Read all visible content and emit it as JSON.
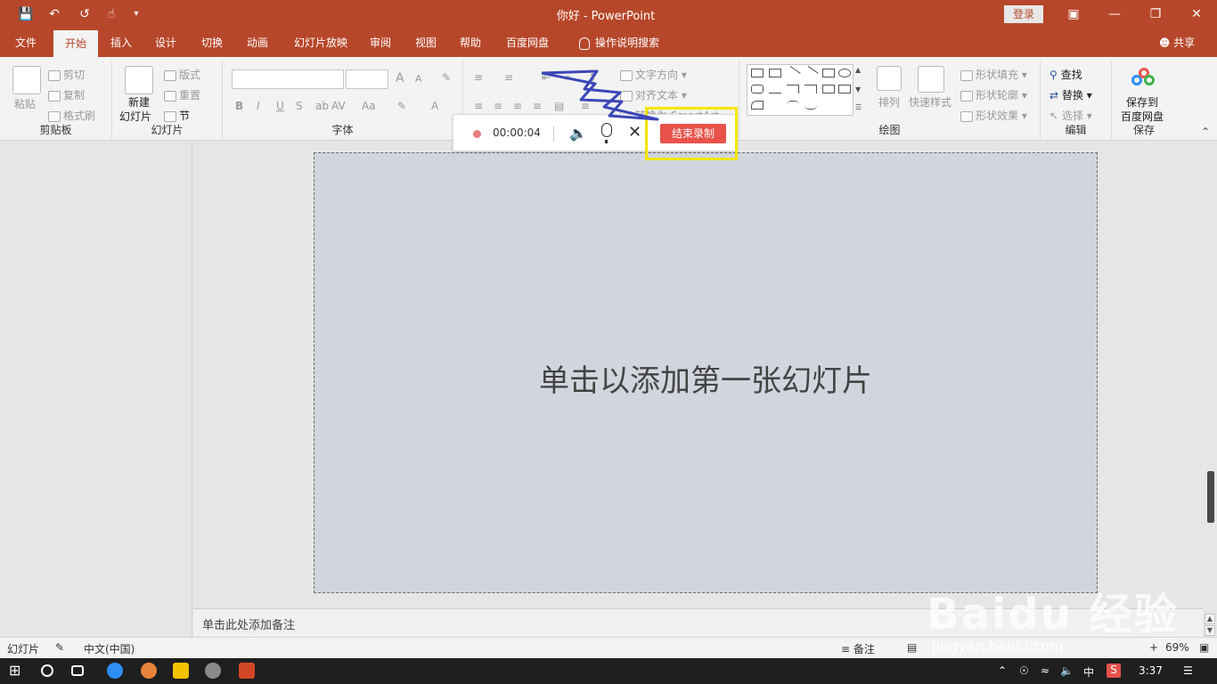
{
  "titlebar": {
    "title": "你好  -  PowerPoint",
    "login_label": "登录",
    "quick_access": [
      "save-icon",
      "undo-icon",
      "redo-icon",
      "touch-mode-icon",
      "customize-icon"
    ]
  },
  "tabs": {
    "file": "文件",
    "home": "开始",
    "insert": "插入",
    "design": "设计",
    "transitions": "切换",
    "animations": "动画",
    "slideshow": "幻灯片放映",
    "review": "审阅",
    "view": "视图",
    "help": "帮助",
    "baidu": "百度网盘",
    "tellme": "操作说明搜索",
    "share": "共享"
  },
  "ribbon": {
    "clipboard": {
      "paste": "粘贴",
      "cut": "剪切",
      "copy": "复制",
      "format_painter": "格式刷",
      "label": "剪贴板"
    },
    "slides": {
      "new_slide": "新建",
      "new_slide2": "幻灯片",
      "layout": "版式",
      "reset": "重置",
      "section": "节",
      "label": "幻灯片"
    },
    "font": {
      "label": "字体",
      "bold": "B",
      "italic": "I",
      "underline": "U",
      "shadow": "S",
      "size_up": "A",
      "size_down": "A",
      "case": "Aa"
    },
    "paragraph": {
      "text_direction": "文字方向",
      "align_text": "对齐文本",
      "smartart": "转换为 SmartArt"
    },
    "drawing": {
      "arrange": "排列",
      "quick_styles": "快速样式",
      "shape_fill": "形状填充",
      "shape_outline": "形状轮廓",
      "shape_effects": "形状效果",
      "label": "绘图"
    },
    "editing": {
      "find": "查找",
      "replace": "替换",
      "select": "选择",
      "label": "编辑"
    },
    "save": {
      "save_to": "保存到",
      "baidu_disk": "百度网盘",
      "label": "保存"
    }
  },
  "recorder": {
    "time": "00:00:04",
    "end_label": "结束录制"
  },
  "slide": {
    "placeholder": "单击以添加第一张幻灯片"
  },
  "notes": {
    "placeholder": "单击此处添加备注"
  },
  "statusbar": {
    "slide_label": "幻灯片",
    "language": "中文(中国)",
    "notes": "备注",
    "zoom": "69%"
  },
  "watermark": {
    "brand": "Baidu 经验",
    "url": "jingyan.baidu.com"
  },
  "taskbar": {
    "ime": "中",
    "time": "3:37"
  },
  "colors": {
    "accent": "#b7472a",
    "end_button": "#e8524a",
    "highlight": "#f5e600",
    "annotation_arrow": "#3b47b8"
  }
}
